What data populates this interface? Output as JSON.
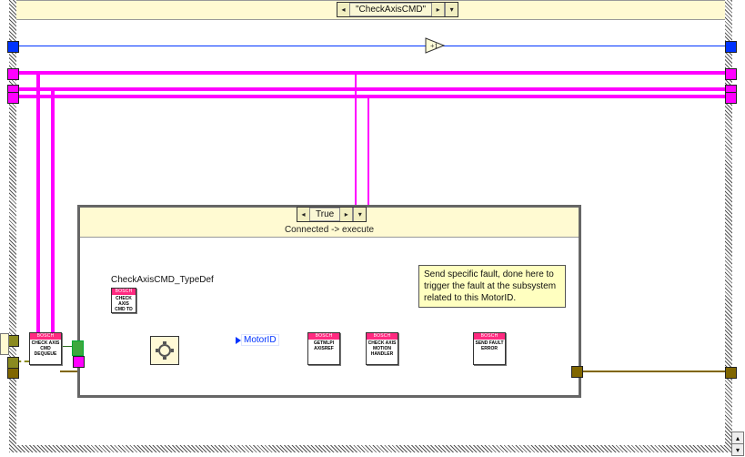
{
  "outer_case": {
    "selector_label": "\"CheckAxisCMD\""
  },
  "inner_case": {
    "selector_label": "True",
    "subdiagram_label": "Connected -> execute"
  },
  "labels": {
    "typedef": "CheckAxisCMD_TypeDef",
    "motor_id": "MotorID"
  },
  "nodes": {
    "brand": "BOSCH",
    "typedef_icon": "CHECK AXIS CMD TD",
    "dequeue": "CHECK AXIS CMD DEQUEUE",
    "getmlpi": "GETMLPI AXISREF",
    "motionhandler": "CHECK AXIS MOTION HANDLER",
    "sendfault": "SEND FAULT ERROR"
  },
  "comment": "Send specific fault, done here to trigger the fault at the subsystem related to this MotorID.",
  "increment_label": "+1"
}
